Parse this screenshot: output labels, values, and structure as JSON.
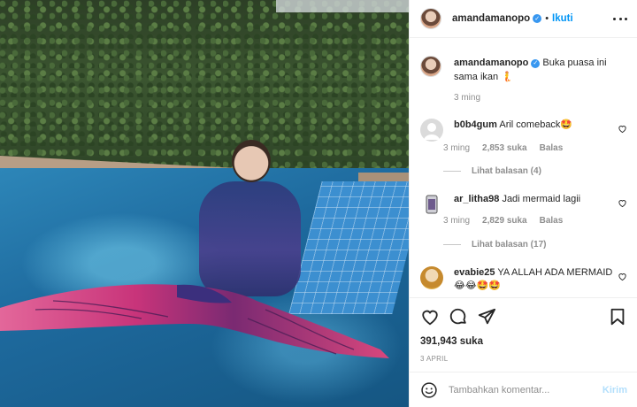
{
  "post": {
    "author": "amandamanopo",
    "follow_label": "Ikuti",
    "separator": "•",
    "verified_mark": "✓"
  },
  "caption": {
    "author": "amandamanopo",
    "text": "Buka puasa ini sama ikan 🧜",
    "time": "3 ming"
  },
  "comments": [
    {
      "author": "b0b4gum",
      "text": "Aril comeback🤩",
      "time": "3 ming",
      "likes": "2,853 suka",
      "reply_label": "Balas",
      "view_replies": "Lihat balasan (4)"
    },
    {
      "author": "ar_litha98",
      "text": "Jadi mermaid lagii",
      "time": "3 ming",
      "likes": "2,829 suka",
      "reply_label": "Balas",
      "view_replies": "Lihat balasan (17)"
    },
    {
      "author": "evabie25",
      "text": "YA ALLAH ADA MERMAID 😂😂🤩🤩"
    }
  ],
  "stats": {
    "likes": "391,943 suka",
    "date": "3 APRIL"
  },
  "composer": {
    "placeholder": "Tambahkan komentar...",
    "post_label": "Kirim"
  },
  "icons": {
    "more": "more-options-icon",
    "like": "heart-icon",
    "comment": "comment-icon",
    "share": "paper-plane-icon",
    "save": "bookmark-icon",
    "emoji": "emoji-icon"
  },
  "colors": {
    "accent": "#0095f6",
    "post_disabled": "#b2dffc",
    "muted": "#8e8e8e",
    "verified": "#3897f0"
  }
}
